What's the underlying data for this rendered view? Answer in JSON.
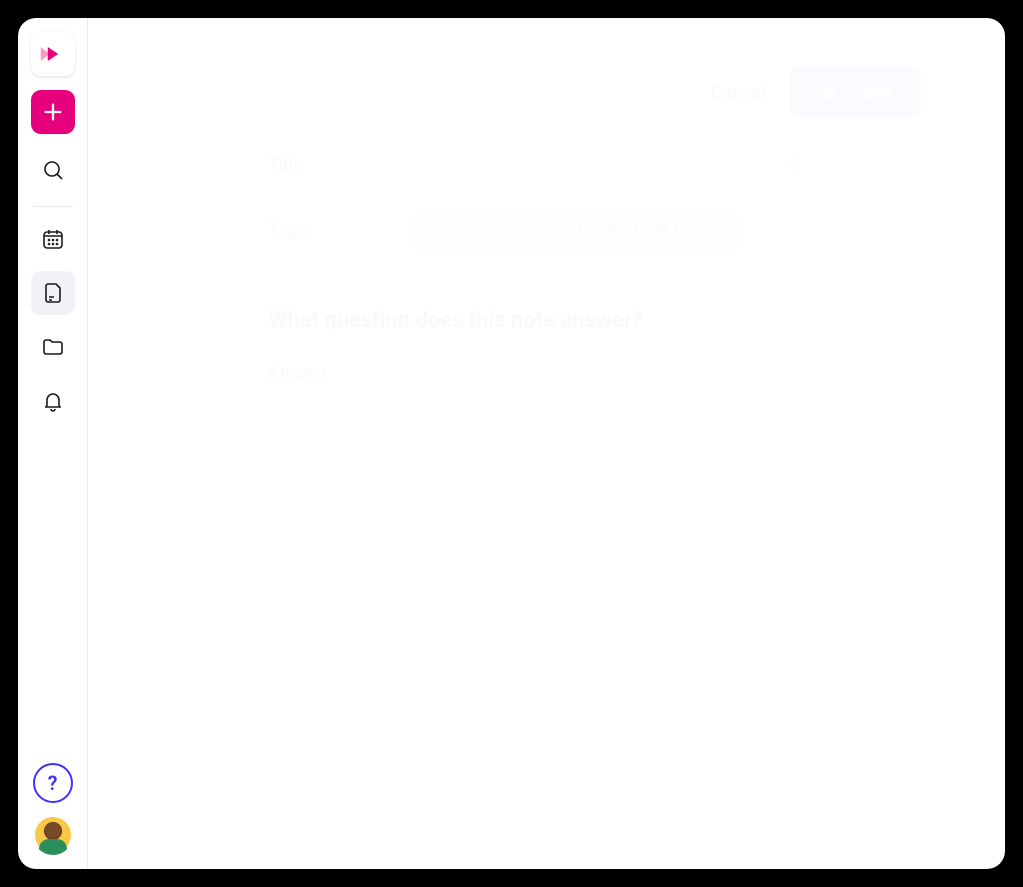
{
  "sidebar": {
    "logo_name": "app-logo",
    "items": [
      {
        "name": "search",
        "active": false
      },
      {
        "name": "calendar",
        "active": false
      },
      {
        "name": "notes",
        "active": true
      },
      {
        "name": "folder",
        "active": false
      },
      {
        "name": "bell",
        "active": false
      }
    ],
    "help_label": "?",
    "avatar_name": "user-avatar"
  },
  "header": {
    "cancel_label": "Cancel",
    "save_label": "Save"
  },
  "form": {
    "title_label": "Title",
    "title_placeholder": "",
    "hash_label": "#",
    "tags_label": "Tags",
    "tag_value": "Crisis Communications Cheat Che",
    "tag_close": "×"
  },
  "question": {
    "title": "What question does this note answer?",
    "answer_label": "Answer",
    "answer_placeholder": ""
  }
}
